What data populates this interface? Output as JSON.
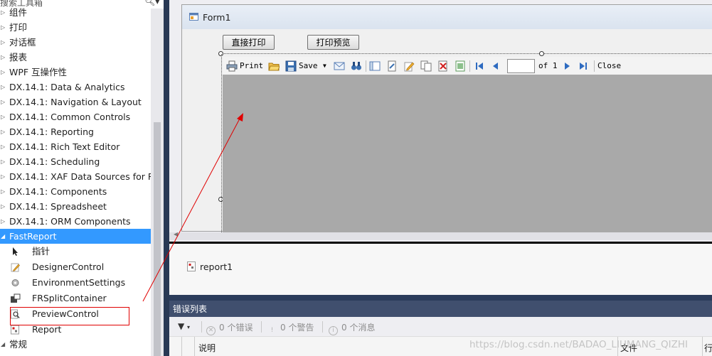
{
  "toolbox": {
    "search_placeholder": "搜索工具箱",
    "search_icon": "magnifier-icon",
    "categories": [
      {
        "label": "组件",
        "expanded": false
      },
      {
        "label": "打印",
        "expanded": false
      },
      {
        "label": "对话框",
        "expanded": false
      },
      {
        "label": "报表",
        "expanded": false
      },
      {
        "label": "WPF 互操作性",
        "expanded": false
      },
      {
        "label": "DX.14.1: Data & Analytics",
        "expanded": false
      },
      {
        "label": "DX.14.1: Navigation & Layout",
        "expanded": false
      },
      {
        "label": "DX.14.1: Common Controls",
        "expanded": false
      },
      {
        "label": "DX.14.1: Reporting",
        "expanded": false
      },
      {
        "label": "DX.14.1: Rich Text Editor",
        "expanded": false
      },
      {
        "label": "DX.14.1: Scheduling",
        "expanded": false
      },
      {
        "label": "DX.14.1: XAF Data Sources for R...",
        "expanded": false
      },
      {
        "label": "DX.14.1: Components",
        "expanded": false
      },
      {
        "label": "DX.14.1: Spreadsheet",
        "expanded": false
      },
      {
        "label": "DX.14.1: ORM Components",
        "expanded": false
      }
    ],
    "fastreport": {
      "label": "FastReport",
      "items": [
        {
          "label": "指针",
          "icon": "pointer-icon"
        },
        {
          "label": "DesignerControl",
          "icon": "pencil-icon"
        },
        {
          "label": "EnvironmentSettings",
          "icon": "gear-icon"
        },
        {
          "label": "FRSplitContainer",
          "icon": "split-container-icon"
        },
        {
          "label": "PreviewControl",
          "icon": "preview-icon"
        },
        {
          "label": "Report",
          "icon": "report-icon"
        }
      ]
    },
    "general_label": "常规"
  },
  "form": {
    "title": "Form1",
    "button_direct_print": "直接打印",
    "button_print_preview": "打印预览"
  },
  "preview_toolbar": {
    "print": "Print",
    "save": "Save",
    "of": "of 1",
    "close": "Close",
    "page_value": ""
  },
  "tray": {
    "component": "report1"
  },
  "error_list": {
    "title": "错误列表",
    "errors": "0 个错误",
    "warnings": "0 个警告",
    "messages": "0 个消息",
    "col_description": "说明",
    "col_file": "文件",
    "col_line": "行"
  },
  "watermark": "https://blog.csdn.net/BADAO_LIUMANG_QIZHI",
  "colors": {
    "selection": "#3399ff",
    "highlight_box": "#e00000",
    "annotation_arrow": "#e00000",
    "preview_background": "#a9a9a9",
    "panel_title": "#404f6e"
  }
}
